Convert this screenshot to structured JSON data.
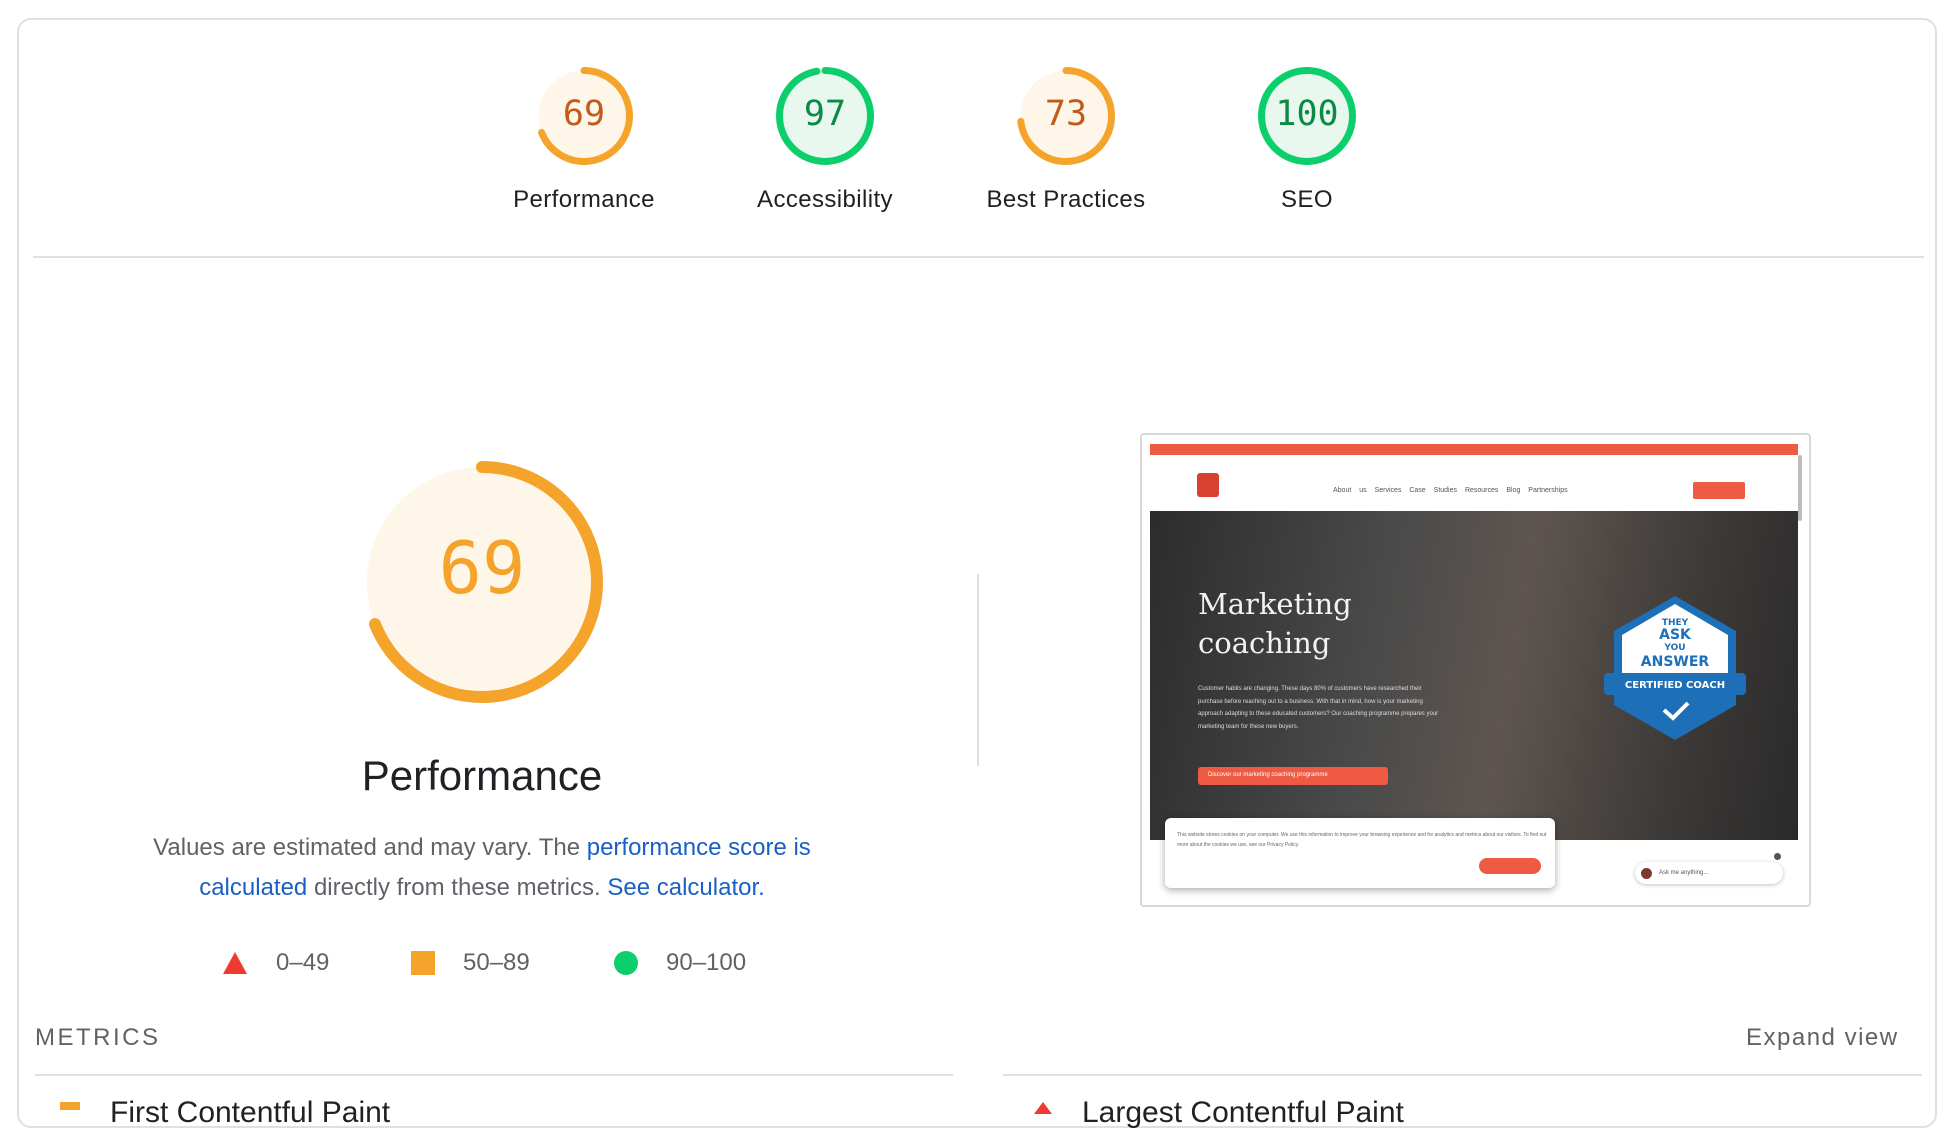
{
  "categories": [
    {
      "id": "performance",
      "score": "69",
      "label": "Performance",
      "fraction": 0.69,
      "color": "#f4a42a",
      "text_color": "#c25b1a",
      "bg": "#fff6ea"
    },
    {
      "id": "accessibility",
      "score": "97",
      "label": "Accessibility",
      "fraction": 0.97,
      "color": "#0cce6b",
      "text_color": "#0b8a43",
      "bg": "#e8f8ee"
    },
    {
      "id": "best-practices",
      "score": "73",
      "label": "Best Practices",
      "fraction": 0.73,
      "color": "#f4a42a",
      "text_color": "#c25b1a",
      "bg": "#fff6ea"
    },
    {
      "id": "seo",
      "score": "100",
      "label": "SEO",
      "fraction": 1.0,
      "color": "#0cce6b",
      "text_color": "#0b8a43",
      "bg": "#e8f8ee"
    }
  ],
  "main": {
    "score": "69",
    "fraction": 0.69,
    "title": "Performance",
    "desc_prefix": "Values are estimated and may vary. The ",
    "desc_link1": "performance score is calculated",
    "desc_middle": " directly from these metrics. ",
    "desc_link2": "See calculator.",
    "color": "#f4a42a",
    "bg": "#fff6ea"
  },
  "legend": [
    {
      "range": "0–49",
      "icon": "triangle-icon",
      "color": "#ee3a2f"
    },
    {
      "range": "50–89",
      "icon": "square-icon",
      "color": "#f4a42a"
    },
    {
      "range": "90–100",
      "icon": "circle-icon",
      "color": "#0cce6b"
    }
  ],
  "screenshot": {
    "nav_links": "About us   Services   Case Studies   Resources   Blog   Partnerships",
    "headline": "Marketing coaching",
    "paragraph": "Customer habits are changing. These days 80% of customers have researched their purchase before reaching out to a business. With that in mind, how is your marketing approach adapting to these educated customers? Our coaching programme prepares your marketing team for these new buyers.",
    "cta": "Discover our marketing coaching programme",
    "badge_top": "THEY",
    "badge_ask": "ASK",
    "badge_you": "YOU",
    "badge_answer": "ANSWER",
    "badge_certified": "CERTIFIED COACH",
    "cookie_text": "This website stores cookies on your computer. We use this information to improve your browsing experience and for analytics and metrics about our visitors. To find out more about the cookies we use, see our Privacy Policy.",
    "chat_text": "Ask me anything..."
  },
  "metrics": {
    "heading": "METRICS",
    "expand": "Expand view",
    "first_metric": "First Contentful Paint",
    "second_metric": "Largest Contentful Paint"
  }
}
